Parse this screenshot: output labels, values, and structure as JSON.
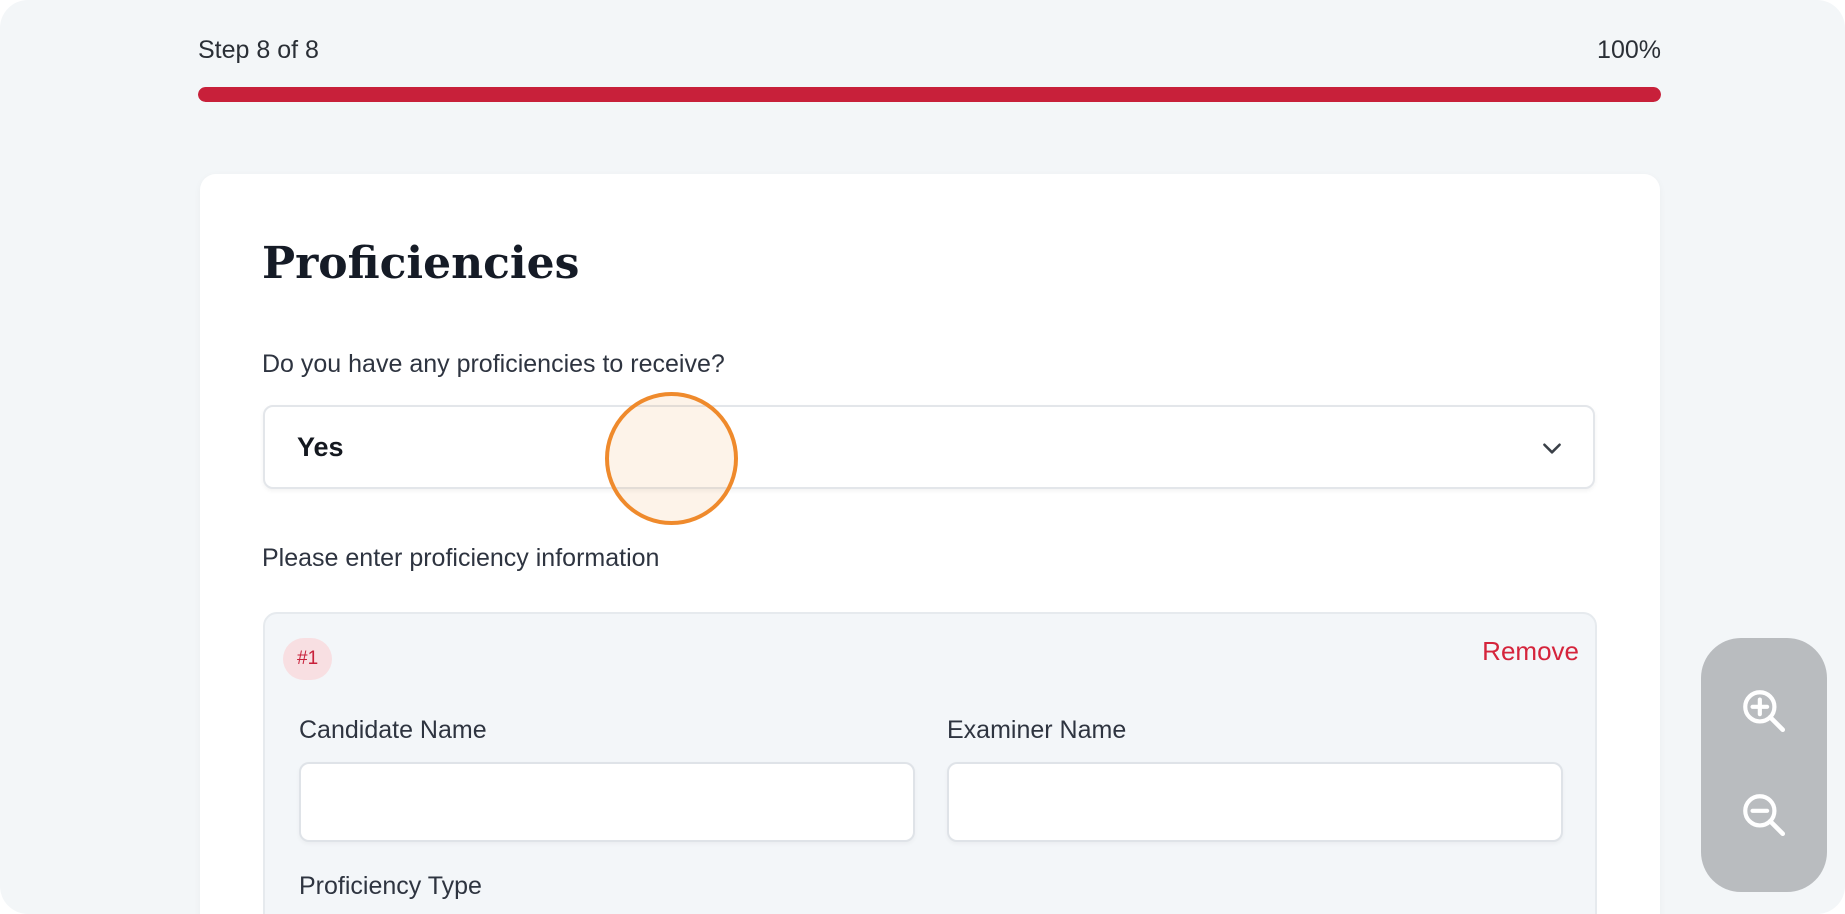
{
  "progress": {
    "step_label": "Step 8 of 8",
    "percent_label": "100%",
    "fraction": 1.0,
    "fill_color": "#c8203a"
  },
  "section": {
    "title": "Proficiencies",
    "question": "Do you have any proficiencies to receive?",
    "select_value": "Yes",
    "select_icon": "chevron-down-icon",
    "helper_text": "Please enter proficiency information"
  },
  "entry": {
    "badge": "#1",
    "remove_label": "Remove",
    "fields": {
      "candidate_label": "Candidate Name",
      "candidate_value": "",
      "examiner_label": "Examiner Name",
      "examiner_value": "",
      "type_label": "Proficiency Type"
    }
  },
  "zoom": {
    "zoom_in_icon": "zoom-in-icon",
    "zoom_out_icon": "zoom-out-icon"
  },
  "colors": {
    "accent": "#c8203a",
    "click_indicator": "#ef8a2c"
  }
}
